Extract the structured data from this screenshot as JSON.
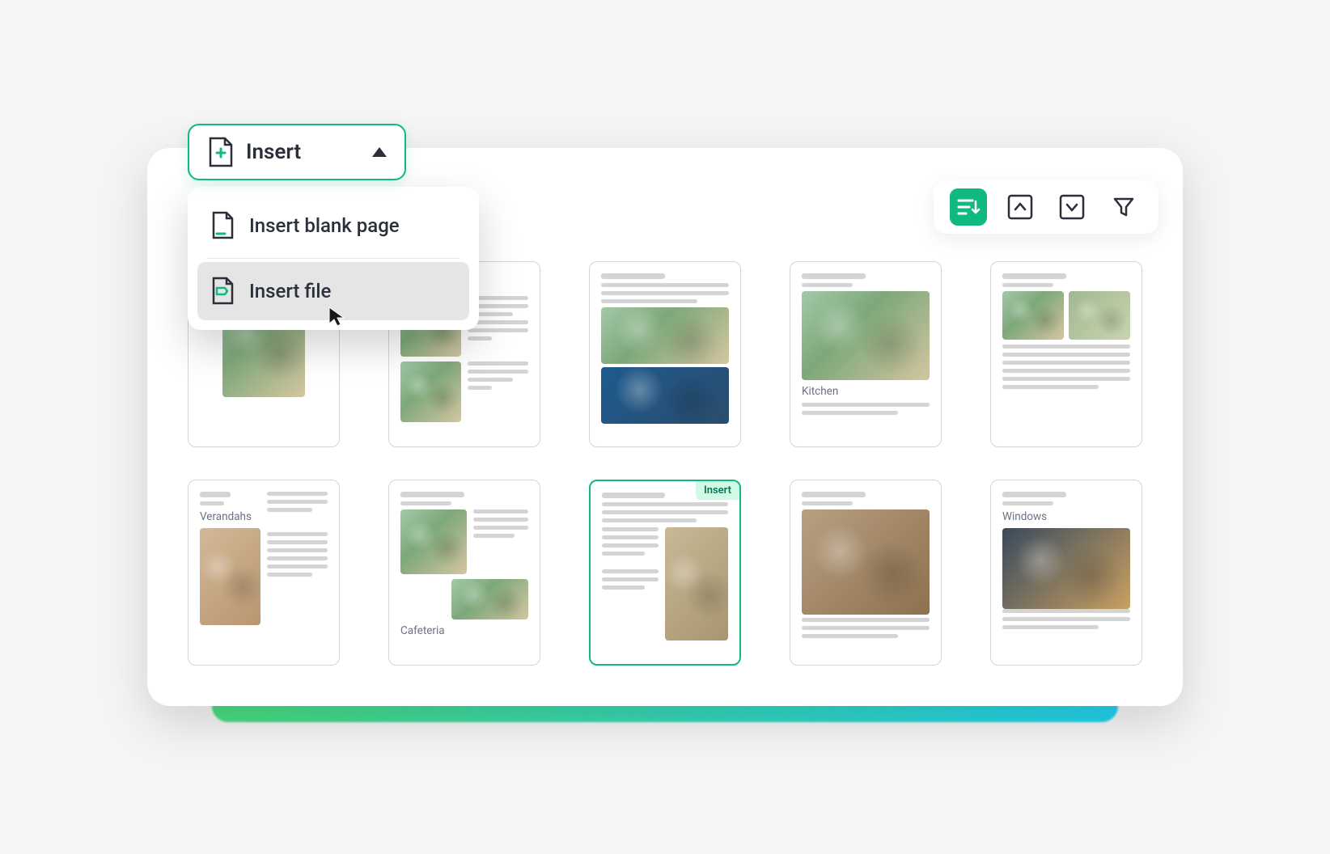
{
  "insert_button": {
    "label": "Insert"
  },
  "dropdown": {
    "items": [
      {
        "label": "Insert blank page",
        "icon": "blank-page-icon"
      },
      {
        "label": "Insert file",
        "icon": "file-icon"
      }
    ]
  },
  "toolbar": {
    "sort": "sort-icon",
    "collapse": "chevron-up-icon",
    "expand": "chevron-down-icon",
    "filter": "filter-icon"
  },
  "thumbs": [
    {
      "label": "",
      "selected": false,
      "badge": ""
    },
    {
      "label": "",
      "selected": false,
      "badge": ""
    },
    {
      "label": "",
      "selected": false,
      "badge": ""
    },
    {
      "label": "Kitchen",
      "selected": false,
      "badge": ""
    },
    {
      "label": "",
      "selected": false,
      "badge": ""
    },
    {
      "label": "Verandahs",
      "selected": false,
      "badge": ""
    },
    {
      "label": "Cafeteria",
      "selected": false,
      "badge": ""
    },
    {
      "label": "",
      "selected": true,
      "badge": "Insert"
    },
    {
      "label": "",
      "selected": false,
      "badge": ""
    },
    {
      "label": "Windows",
      "selected": false,
      "badge": ""
    }
  ],
  "colors": {
    "accent": "#10b981",
    "text": "#2a2f3a"
  }
}
